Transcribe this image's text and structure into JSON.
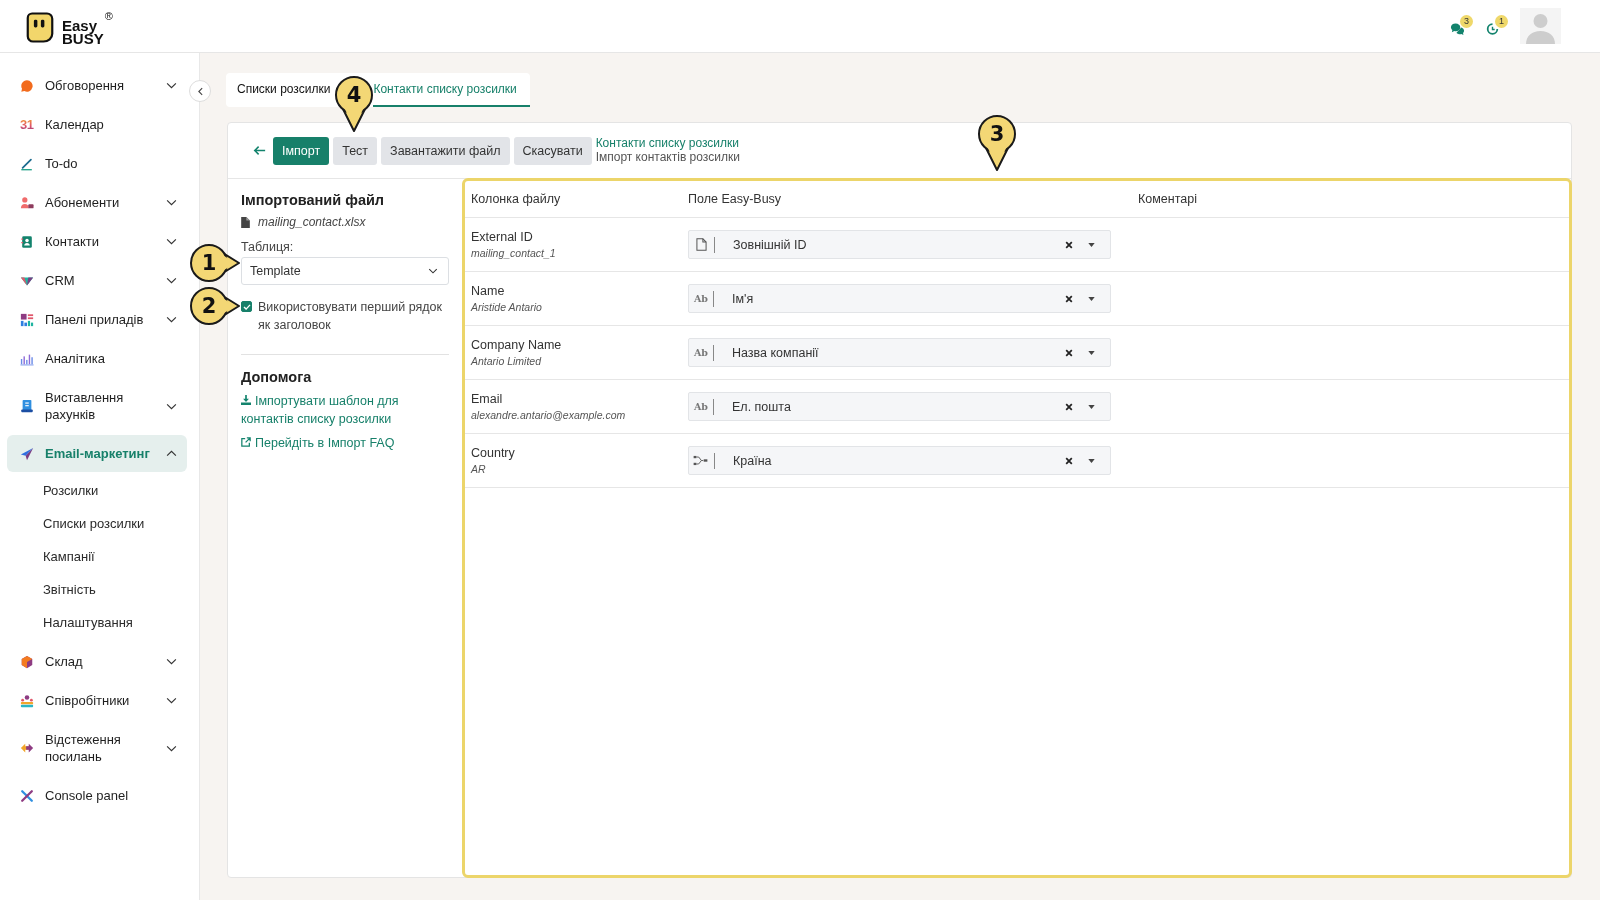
{
  "logo": {
    "lines": [
      "Easy",
      "BUSY"
    ],
    "mark": "®"
  },
  "top_bar": {
    "notifications": [
      {
        "kind": "chat",
        "count": "3"
      },
      {
        "kind": "activity",
        "count": "1"
      }
    ]
  },
  "sidebar": {
    "items": [
      {
        "label": "Обговорення",
        "expandable": true,
        "expanded": false,
        "selected": false
      },
      {
        "label": "Календар",
        "icon_text": "31",
        "expandable": false,
        "selected": false
      },
      {
        "label": "To-do",
        "expandable": false,
        "selected": false
      },
      {
        "label": "Абонементи",
        "expandable": true,
        "expanded": false,
        "selected": false
      },
      {
        "label": "Контакти",
        "expandable": true,
        "expanded": false,
        "selected": false
      },
      {
        "label": "CRM",
        "expandable": true,
        "expanded": false,
        "selected": false
      },
      {
        "label": "Панелі приладів",
        "expandable": true,
        "expanded": false,
        "selected": false
      },
      {
        "label": "Аналітика",
        "expandable": false,
        "selected": false
      },
      {
        "label": "Виставлення рахунків",
        "expandable": true,
        "expanded": false,
        "selected": false
      },
      {
        "label": "Email-маркетинг",
        "expandable": true,
        "expanded": true,
        "selected": true,
        "children": [
          {
            "label": "Розсилки",
            "selected": false
          },
          {
            "label": "Списки розсилки",
            "selected": false
          },
          {
            "label": "Кампанії",
            "selected": false
          },
          {
            "label": "Звітність",
            "selected": false
          },
          {
            "label": "Налаштування",
            "selected": false
          }
        ]
      },
      {
        "label": "Склад",
        "expandable": true,
        "expanded": false,
        "selected": false
      },
      {
        "label": "Співробітники",
        "expandable": true,
        "expanded": false,
        "selected": false
      },
      {
        "label": "Відстеження посилань",
        "expandable": true,
        "expanded": false,
        "selected": false
      },
      {
        "label": "Console panel",
        "expandable": false,
        "selected": false
      }
    ]
  },
  "tabs": [
    {
      "label": "Списки розсилки",
      "selected": false
    },
    {
      "label": "Контакти списку розсилки",
      "selected": true
    }
  ],
  "toolbar": {
    "buttons": [
      {
        "label": "Імпорт",
        "primary": true
      },
      {
        "label": "Тест",
        "primary": false
      },
      {
        "label": "Завантажити файл",
        "primary": false
      },
      {
        "label": "Скасувати",
        "primary": false
      }
    ],
    "breadcrumb": {
      "parent": "Контакти списку розсилки",
      "current": "Імпорт контактів розсилки"
    }
  },
  "import_panel": {
    "heading": "Імпортований файл",
    "file_name": "mailing_contact.xlsx",
    "sheet_label": "Таблиця:",
    "sheet_value": "Template",
    "header_checkbox": {
      "label": "Використовувати перший рядок як заголовок",
      "checked": true
    },
    "help_heading": "Допомога",
    "help_links": [
      {
        "kind": "download",
        "label": "Імпортувати шаблон для контактів списку розсилки"
      },
      {
        "kind": "external",
        "label": "Перейдіть в Імпорт FAQ"
      }
    ]
  },
  "mapping": {
    "highlighted": true,
    "columns": [
      "Колонка файлу",
      "Поле Easy-Busy",
      "Коментарі"
    ],
    "rows": [
      {
        "column": "External ID",
        "sample": "mailing_contact_1",
        "field_type": {
          "kind": "file"
        },
        "field": "Зовнішній ID"
      },
      {
        "column": "Name",
        "sample": "Aristide Antario",
        "field_type": {
          "kind": "text",
          "label": "Ab"
        },
        "field": "Ім'я"
      },
      {
        "column": "Company Name",
        "sample": "Antario Limited",
        "field_type": {
          "kind": "text",
          "label": "Ab"
        },
        "field": "Назва компанії"
      },
      {
        "column": "Email",
        "sample": "alexandre.antario@example.com",
        "field_type": {
          "kind": "text",
          "label": "Ab"
        },
        "field": "Ел. пошта"
      },
      {
        "column": "Country",
        "sample": "AR",
        "field_type": {
          "kind": "relation"
        },
        "field": "Країна"
      }
    ]
  },
  "callouts": [
    {
      "number": "1",
      "kind": "right"
    },
    {
      "number": "2",
      "kind": "right"
    },
    {
      "number": "3",
      "kind": "down"
    },
    {
      "number": "4",
      "kind": "down"
    }
  ]
}
